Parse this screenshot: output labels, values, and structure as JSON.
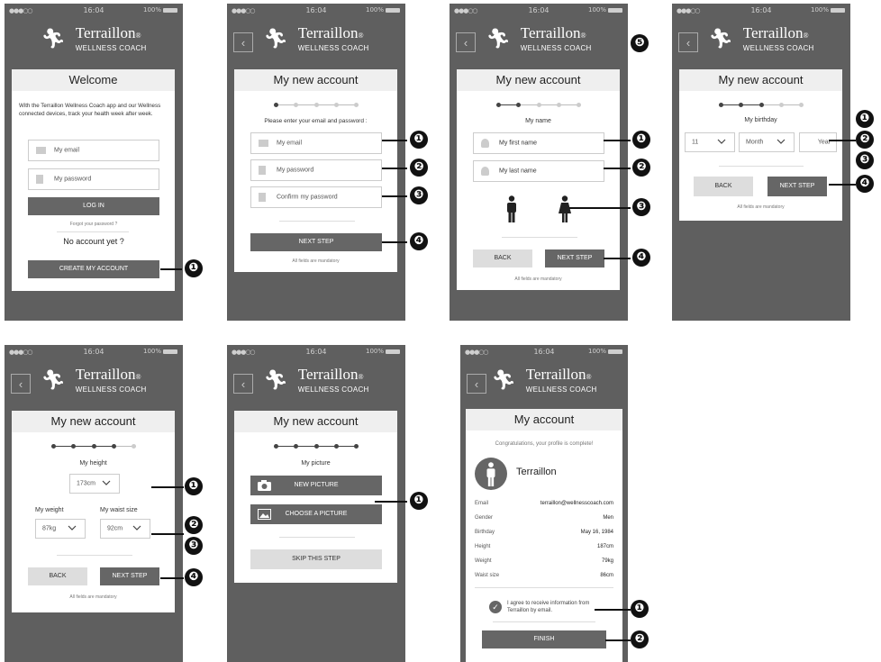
{
  "status": {
    "carrier": "●●●○○",
    "time": "16:04",
    "battery": "100%"
  },
  "brand": {
    "name": "Terraillon",
    "trademark": "®",
    "sub": "WELLNESS COACH"
  },
  "icons": {
    "back": "‹",
    "check": "✓",
    "camera": "camera-icon",
    "image": "image-icon",
    "person": "person-icon"
  },
  "screen1": {
    "title": "Welcome",
    "intro": "With the Terraillon Wellness Coach app and our Wellness connected devices, track your health week after week.",
    "email_placeholder": "My email",
    "password_placeholder": "My password",
    "login": "LOG IN",
    "forgot": "Forgot your password ?",
    "no_account": "No account yet ?",
    "create": "CREATE MY ACCOUNT",
    "callouts": [
      "❶"
    ]
  },
  "screen2": {
    "title": "My new account",
    "prompt": "Please enter your email and password :",
    "email": "My email",
    "password": "My password",
    "confirm": "Confirm my password",
    "next": "NEXT STEP",
    "note": "All fields are mandatory",
    "callouts": [
      "❶",
      "❷",
      "❸",
      "❹"
    ]
  },
  "screen3": {
    "title": "My new account",
    "section": "My name",
    "first": "My first name",
    "last": "My last name",
    "back": "BACK",
    "next": "NEXT STEP",
    "note": "All fields are mandatory",
    "callouts": [
      "❶",
      "❷",
      "❸",
      "❹",
      "❺"
    ]
  },
  "screen4": {
    "title": "My new account",
    "section": "My birthday",
    "day": "11",
    "month": "Month",
    "year": "Year",
    "back": "BACK",
    "next": "NEXT STEP",
    "note": "All fields are mandatory",
    "callouts": [
      "❶",
      "❷",
      "❸",
      "❹"
    ]
  },
  "screen5": {
    "title": "My new account",
    "height_label": "My height",
    "height": "173cm",
    "weight_label": "My weight",
    "weight": "87kg",
    "waist_label": "My waist size",
    "waist": "92cm",
    "back": "BACK",
    "next": "NEXT STEP",
    "note": "All fields are mandatory",
    "callouts": [
      "❶",
      "❷",
      "❸",
      "❹"
    ]
  },
  "screen6": {
    "title": "My new account",
    "section": "My picture",
    "new_picture": "NEW PICTURE",
    "choose": "CHOOSE A PICTURE",
    "skip": "SKIP THIS STEP",
    "callouts": [
      "❶"
    ]
  },
  "screen7": {
    "title": "My account",
    "congrats": "Congratulations, your profile is complete!",
    "name": "Terraillon",
    "rows": [
      {
        "k": "Email",
        "v": "terraillon@wellnesscoach.com"
      },
      {
        "k": "Gender",
        "v": "Men"
      },
      {
        "k": "Birthday",
        "v": "May 16, 1984"
      },
      {
        "k": "Height",
        "v": "187cm"
      },
      {
        "k": "Weight",
        "v": "79kg"
      },
      {
        "k": "Waist size",
        "v": "86cm"
      }
    ],
    "agree": "I agree to receive information from Terraillon by email.",
    "finish": "FINISH",
    "callouts": [
      "❶",
      "❷"
    ]
  }
}
